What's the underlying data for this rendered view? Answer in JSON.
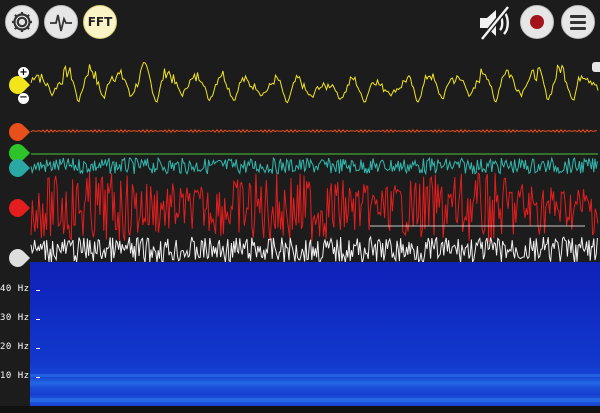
{
  "toolbar": {
    "settings_icon": "gear-icon",
    "signal_icon": "waveform-icon",
    "fft_label": "FFT",
    "mute_icon": "speaker-muted-icon",
    "record_icon": "record-icon",
    "menu_icon": "hamburger-menu-icon"
  },
  "channels": [
    {
      "color": "#f2e51c",
      "marker_color": "#f2e51c"
    },
    {
      "color": "#e8501b",
      "marker_color": "#e8501b"
    },
    {
      "color": "#49c83c",
      "marker_color": "#2fc32a"
    },
    {
      "color": "#33b7ad",
      "marker_color": "#2aa9a4"
    },
    {
      "color": "#e21e1e",
      "marker_color": "#e21e1e"
    },
    {
      "color": "#f1f1f1",
      "marker_color": "#dedede"
    }
  ],
  "zoom": {
    "plus_label": "+",
    "minus_label": "−"
  },
  "spectrogram": {
    "frequency_labels": [
      "40 Hz",
      "30 Hz",
      "20 Hz",
      "10 Hz"
    ],
    "colors": [
      "#0f22b8",
      "#1846d6",
      "#2368e4"
    ]
  }
}
